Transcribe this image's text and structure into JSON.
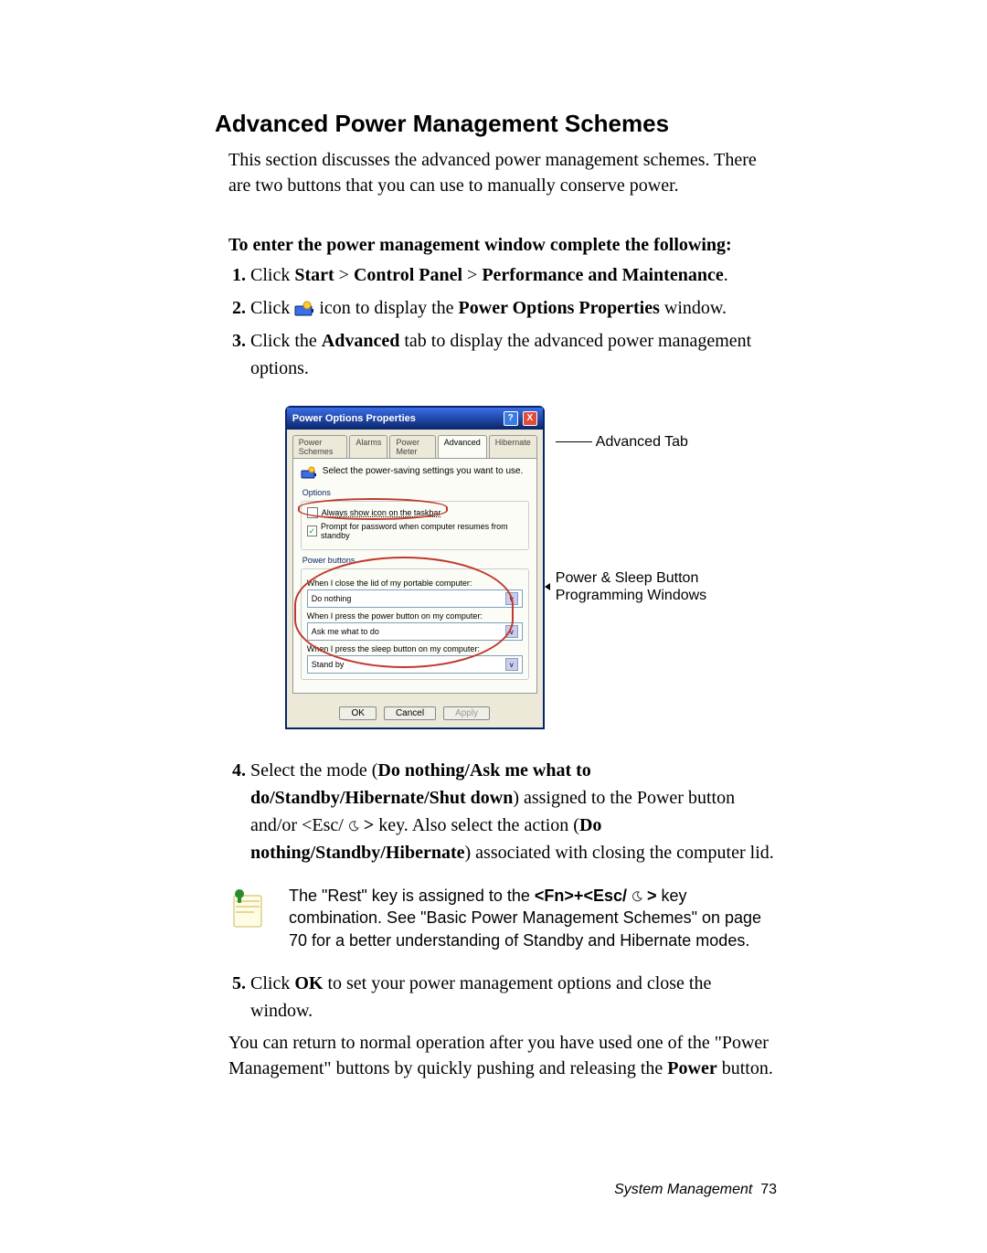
{
  "headings": {
    "main": "Advanced Power Management Schemes",
    "subhead": "To enter the power management window complete the following:"
  },
  "intro": "This section discusses the advanced power management schemes. There are two buttons that you can use to manually conserve power.",
  "steps": {
    "s1_pre": "Click ",
    "s1_b1": "Start",
    "s1_gt1": " > ",
    "s1_b2": "Control Panel",
    "s1_gt2": " > ",
    "s1_b3": "Performance and Maintenance",
    "s1_end": ".",
    "s2_pre": "Click ",
    "s2_mid": " icon to display the ",
    "s2_b1": "Power Options Properties",
    "s2_end": " window.",
    "s3_pre": "Click the ",
    "s3_b1": "Advanced",
    "s3_end": " tab to display the advanced power management options.",
    "s4_pre": "Select the mode (",
    "s4_b1": "Do nothing/Ask me what to do/Standby/Hibernate/Shut down",
    "s4_mid1": ") assigned to the Power button and/or <Esc/ ",
    "s4_b2": " >",
    "s4_mid2": " key. Also select the action (",
    "s4_b3": "Do nothing/Standby/Hibernate",
    "s4_end": ") associated with closing the computer lid.",
    "s5_pre": "Click ",
    "s5_b1": "OK",
    "s5_end": " to set your power management options and close the window."
  },
  "note": {
    "pre": "The \"Rest\" key is assigned to the ",
    "b1": "<Fn>+<Esc/ ",
    "b2": " >",
    "rest": " key combination. See \"Basic Power Management Schemes\" on page 70 for a better understanding of Standby and Hibernate modes."
  },
  "closing": {
    "p1_pre": "You can return to normal operation after you have used one of the \"Power Management\" buttons by quickly pushing and releasing the ",
    "p1_b": "Power",
    "p1_end": " button."
  },
  "dialog": {
    "title": "Power Options Properties",
    "tabs": [
      "Power Schemes",
      "Alarms",
      "Power Meter",
      "Advanced",
      "Hibernate"
    ],
    "active_tab_index": 3,
    "desc": "Select the power-saving settings you want to use.",
    "grp_options": "Options",
    "cb1": "Always show icon on the taskbar",
    "cb2": "Prompt for password when computer resumes from standby",
    "grp_buttons": "Power buttons",
    "dd1_label": "When I close the lid of my portable computer:",
    "dd1_value": "Do nothing",
    "dd2_label": "When I press the power button on my computer:",
    "dd2_value": "Ask me what to do",
    "dd3_label": "When I press the sleep button on my computer:",
    "dd3_value": "Stand by",
    "btn_ok": "OK",
    "btn_cancel": "Cancel",
    "btn_apply": "Apply"
  },
  "annotations": {
    "tab": "Advanced Tab",
    "pw1": "Power  & Sleep Button",
    "pw2": "Programming Windows"
  },
  "footer": {
    "label": "System Management",
    "page": "73"
  },
  "icons": {
    "power_options": "power-options-icon",
    "moon": "moon-icon",
    "note": "note-pin-icon",
    "battery": "battery-gauge-icon"
  }
}
